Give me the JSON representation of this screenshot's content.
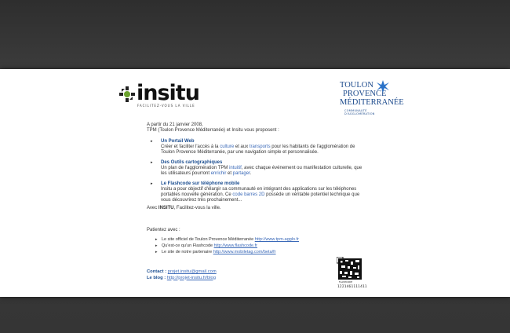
{
  "brand": {
    "insitu_word": "insitu",
    "insitu_tagline": "FACILITEZ-VOUS LA VILLE",
    "tpm_lines": [
      "TOULON",
      "PROVENCE",
      "MÉDITERRANÉE"
    ],
    "tpm_subline": "COMMUNAUTÉ D'AGGLOMÉRATION",
    "accent_color": "#1c4a8c",
    "link_color": "#3a69b8"
  },
  "intro": {
    "line1": "A partir du 21 janvier 2008,",
    "line2": "TPM (Toulon Provence Méditerranée) et Insitu vous proposent :"
  },
  "items": [
    {
      "title": "Un Portail Web",
      "desc_a": "Créer et faciliter l'accès à la ",
      "link1": "culture",
      "desc_b": " et aux ",
      "link2": "transports",
      "desc_c": " pour les habitants de l'agglomération de Toulon Provence Méditerranée, par une navigation simple et personnalisée."
    },
    {
      "title": "Des Outils cartographiques",
      "desc_a": "Un plan de l'agglomération TPM ",
      "link1": "intuitif",
      "desc_b": ", avec chaque événement ou manifestation culturelle, que les utilisateurs pourront ",
      "link2": "enrichir",
      "desc_c": " et ",
      "link3": "partager",
      "desc_d": "."
    },
    {
      "title": "Le Flashcode sur téléphone mobile",
      "desc_a": "Insitu a pour objectif d'élargir sa communauté en intégrant des applications sur les téléphones portables nouvelle génération. Ce ",
      "link1": "code barres 2D",
      "desc_b": " possède un véritable potentiel technique que vous découvrirez très prochainement..."
    }
  ],
  "closing": {
    "prefix": "Avec ",
    "brand": "INSITU",
    "suffix": ", Facilitez-vous la ville."
  },
  "patientez": {
    "heading": "Patientez avec :",
    "links": [
      {
        "text": "Le site officiel de Toulon Provence Méditerranée ",
        "url": "http://www.tpm-agglo.fr"
      },
      {
        "text": "Qu'est-ce qu'un Flashcode ",
        "url": "http://www.flashcode.fr"
      },
      {
        "text": "Le site de notre partenaire ",
        "url": "http://www.mobiletag.com/beta/fr"
      }
    ]
  },
  "contact": {
    "contact_label": "Contact :",
    "contact_value": "projet.insitu@gmail.com",
    "blog_label": "Le blog :",
    "blog_value": "http://projet-insitu.fr/blog"
  },
  "qr": {
    "label": "FLASHCODE",
    "number": "1221461111411"
  }
}
